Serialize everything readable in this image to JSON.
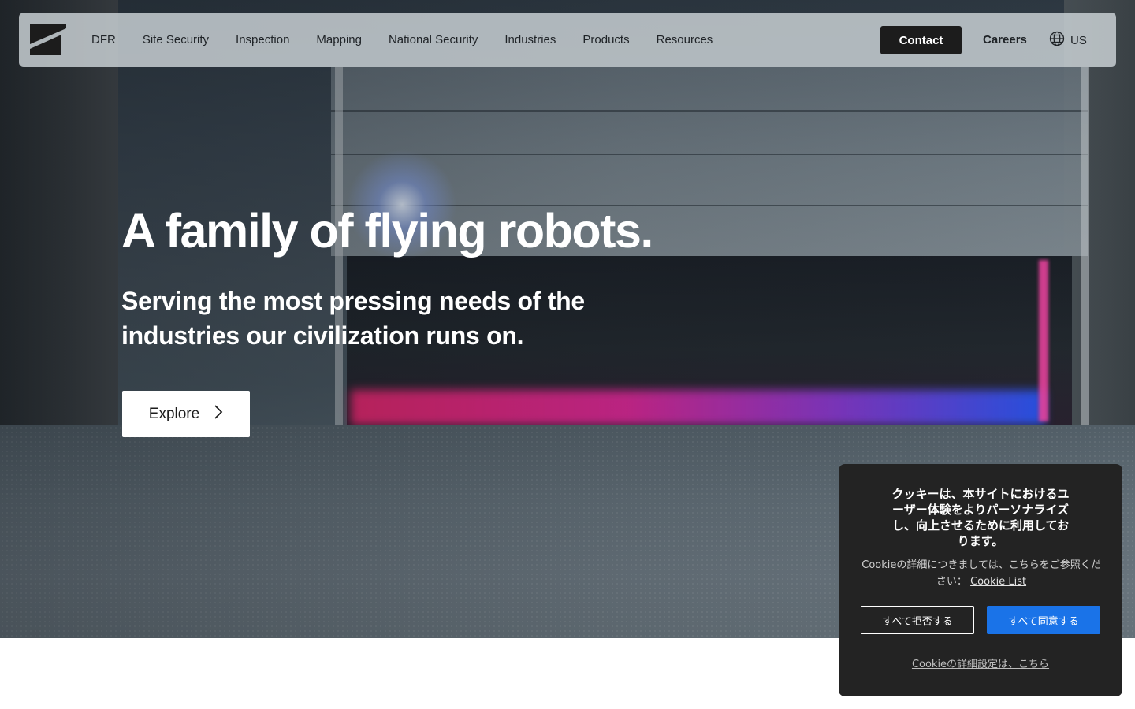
{
  "nav": {
    "items": [
      {
        "label": "DFR"
      },
      {
        "label": "Site Security"
      },
      {
        "label": "Inspection"
      },
      {
        "label": "Mapping"
      },
      {
        "label": "National Security"
      },
      {
        "label": "Industries"
      },
      {
        "label": "Products"
      },
      {
        "label": "Resources"
      }
    ],
    "contact_label": "Contact",
    "careers_label": "Careers",
    "locale_label": "US",
    "locale_icon": "globe-icon",
    "logo_icon": "skydio-logo-icon"
  },
  "hero": {
    "title": "A family of flying robots.",
    "subtitle": "Serving the most pressing needs of the industries our civilization runs on.",
    "explore_label": "Explore",
    "explore_icon": "chevron-right-icon"
  },
  "cookie_banner": {
    "title": "クッキーは、本サイトにおけるユーザー体験をよりパーソナライズし、向上させるために利用しております。",
    "description": "Cookieの詳細につきましては、こちらをご参照ください：",
    "cookie_list_link": "Cookie List",
    "reject_label": "すべて拒否する",
    "accept_label": "すべて同意する",
    "settings_link": "Cookieの詳細設定は、こちら",
    "accept_color": "#1a73e8",
    "background_color": "#232323"
  }
}
